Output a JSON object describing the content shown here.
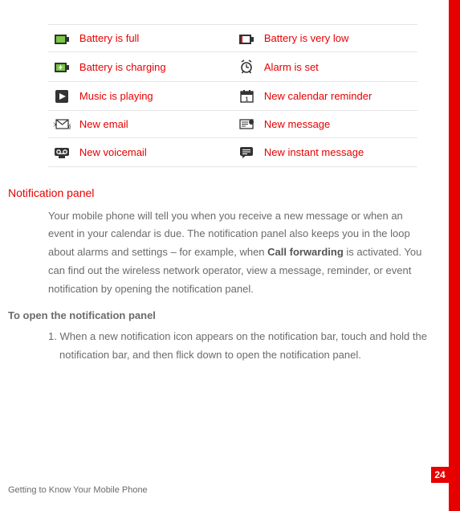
{
  "icons_table": {
    "rows": [
      {
        "left": {
          "icon": "battery-full-icon",
          "label": "Battery is full"
        },
        "right": {
          "icon": "battery-low-icon",
          "label": "Battery is very low"
        }
      },
      {
        "left": {
          "icon": "battery-charging-icon",
          "label": "Battery is charging"
        },
        "right": {
          "icon": "alarm-icon",
          "label": "Alarm is set"
        }
      },
      {
        "left": {
          "icon": "music-playing-icon",
          "label": "Music is playing"
        },
        "right": {
          "icon": "calendar-reminder-icon",
          "label": "New calendar reminder"
        }
      },
      {
        "left": {
          "icon": "new-email-icon",
          "label": "New email"
        },
        "right": {
          "icon": "new-message-icon",
          "label": "New message"
        }
      },
      {
        "left": {
          "icon": "new-voicemail-icon",
          "label": "New voicemail"
        },
        "right": {
          "icon": "new-instant-message-icon",
          "label": "New instant message"
        }
      }
    ]
  },
  "section": {
    "heading": "Notification  panel",
    "para_before_bold": "Your mobile phone will tell you when you receive a new message or when an event in your calendar is due. The notification panel also keeps you in the loop about alarms and settings – for example, when ",
    "bold": "Call forwarding",
    "para_after_bold": " is activated. You can find out the wireless network operator, view a message, reminder, or event notification by opening the notification panel."
  },
  "subsection": {
    "heading": "To open the notification panel",
    "step_num": "1. ",
    "step_text": "When a new notification icon appears on the notification bar, touch and hold the notification bar, and then flick down to open the notification panel."
  },
  "footer": {
    "text": "Getting to Know Your Mobile Phone"
  },
  "page_number": "24",
  "colors": {
    "accent": "#e60000"
  }
}
